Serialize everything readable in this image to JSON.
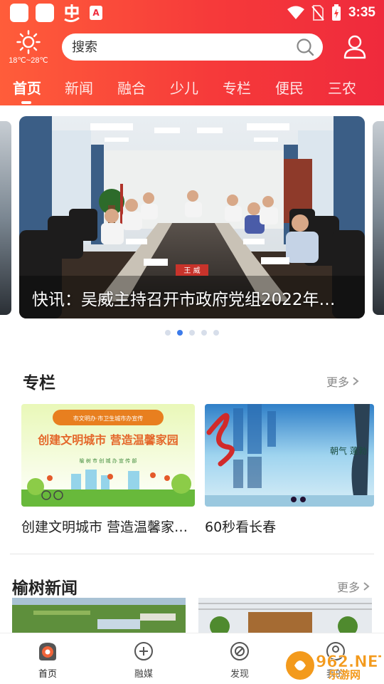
{
  "statusbar": {
    "time": "3:35",
    "pdf_badge": "A"
  },
  "weather": {
    "temp": "18℃~28℃",
    "icon": "sun-icon"
  },
  "search": {
    "placeholder": "搜索"
  },
  "tabs": [
    {
      "label": "首页",
      "active": true
    },
    {
      "label": "新闻"
    },
    {
      "label": "融合"
    },
    {
      "label": "少儿"
    },
    {
      "label": "专栏"
    },
    {
      "label": "便民"
    },
    {
      "label": "三农"
    }
  ],
  "carousel": {
    "caption": "快讯：吴威主持召开市政府党组2022年…",
    "nameplate": "王 威",
    "slide_count": 5,
    "active_index": 1
  },
  "column": {
    "title": "专栏",
    "more": "更多",
    "cards": [
      {
        "title": "创建文明城市 营造温馨家…",
        "banner_line": "创建文明城市 营造温馨家园",
        "banner_top": "市文明办·市卫生城市办宣传",
        "banner_bottom": "榆 树 市 创 城 办 宣 传 部"
      },
      {
        "title": "60秒看长春",
        "overlay_text": "朝气 蓬勃"
      }
    ]
  },
  "yushu": {
    "title": "榆树新闻",
    "more": "更多"
  },
  "bottom_nav": [
    {
      "label": "首页",
      "icon": "home-icon",
      "active": true
    },
    {
      "label": "融媒",
      "icon": "plus-circle-icon"
    },
    {
      "label": "发现",
      "icon": "discover-icon"
    },
    {
      "label": "我的",
      "icon": "user-circle-icon"
    }
  ],
  "watermark": {
    "text": "962.NET",
    "subtext": "乐游网"
  },
  "colors": {
    "brand": "#f63a3a",
    "accent": "#3c7bea"
  }
}
